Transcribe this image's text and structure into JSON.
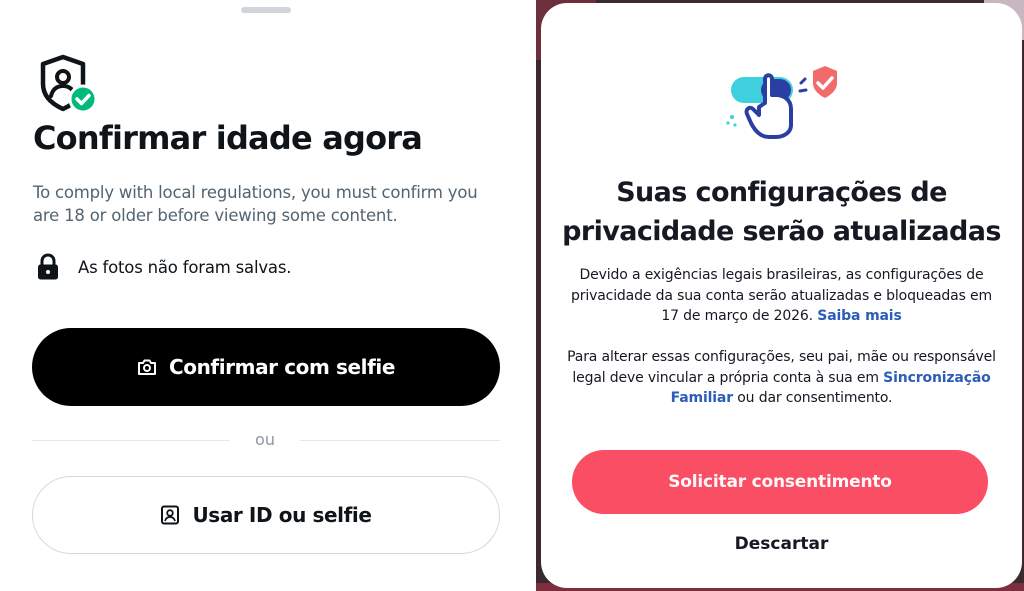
{
  "age_verification": {
    "title": "Confirmar idade agora",
    "description": "To comply with local regulations, you must confirm you are 18 or older before viewing some content.",
    "photo_notice": "As fotos não foram salvas.",
    "selfie_button_label": "Confirmar com selfie",
    "divider_text": "ou",
    "id_button_label": "Usar ID ou selfie",
    "icons": {
      "header": "shield-user-check-icon",
      "photo_notice": "lock-icon",
      "selfie_button": "camera-icon",
      "id_button": "id-card-icon"
    },
    "colors": {
      "primary_button": "#000000",
      "check_badge": "#00ba7c",
      "secondary_text": "#536471"
    }
  },
  "privacy_update": {
    "title_line1": "Suas configurações de",
    "title_line2": "privacidade serão atualizadas",
    "paragraph1": "Devido a exigências legais brasileiras, as configurações de privacidade da sua conta serão atualizadas e bloqueadas em 17 de março de 2026.",
    "learn_more_link": "Saiba mais",
    "paragraph2_prefix": "Para alterar essas configurações, seu pai, mãe ou responsável legal deve vincular a própria conta à sua em",
    "family_pairing_link": "Sincronização Familiar",
    "paragraph2_suffix": "ou dar consentimento.",
    "request_button_label": "Solicitar consentimento",
    "dismiss_label": "Descartar",
    "icons": {
      "illustration": "hand-toggle-shield-illustration"
    },
    "colors": {
      "primary_button": "#f94e63",
      "link": "#2b5db9"
    }
  }
}
